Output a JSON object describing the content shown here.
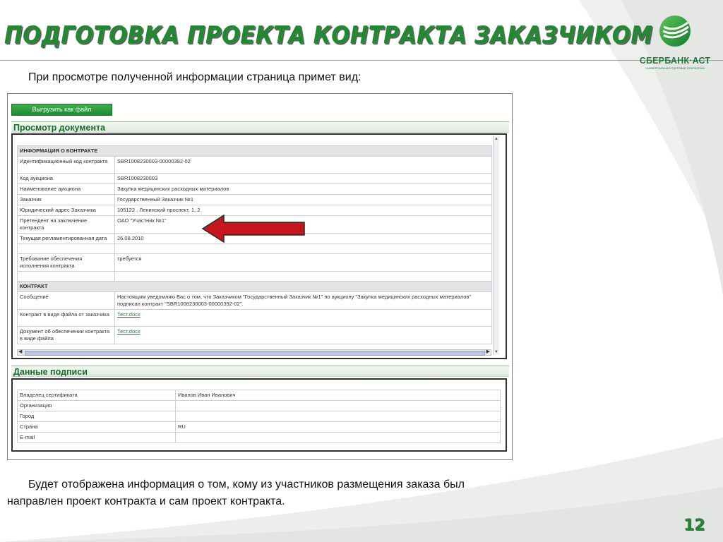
{
  "slide": {
    "title": "ПОДГОТОВКА ПРОЕКТА КОНТРАКТА ЗАКАЗЧИКОМ",
    "intro": "При просмотре полученной информации страница примет вид:",
    "footer_line1": "Будет отображена информация о том, кому из участников размещения заказа был",
    "footer_line2": "направлен проект контракта и сам проект контракта.",
    "page_number": "12"
  },
  "logo": {
    "name": "СБЕРБАНК·АСТ",
    "subtitle": "УНИВЕРСАЛЬНАЯ ТОРГОВАЯ ПЛАТФОРМА"
  },
  "screen": {
    "export_button": "Выгрузить как файл",
    "document_section": "Просмотр документа",
    "signature_section": "Данные подписи",
    "contract_info": {
      "header": "ИНФОРМАЦИЯ О КОНТРАКТЕ",
      "rows": [
        {
          "label": "Идентификационный код контракта",
          "value": "SBR1008230003-00000392-02"
        },
        {
          "label": "Код аукциона",
          "value": "SBR1008230003"
        },
        {
          "label": "Наименование аукциона",
          "value": "Закупка медицинских расходных материалов"
        },
        {
          "label": "Заказчик",
          "value": "Государственный Заказчик №1"
        },
        {
          "label": "Юридический адрес Заказчика",
          "value": "105122 , Ленинский проспект, 1, 2"
        },
        {
          "label": "Претендент на заключение контракта",
          "value": "ОАО \"Участник №1\""
        },
        {
          "label": "Текущая регламентированная дата",
          "value": "26.08.2010"
        },
        {
          "label": "",
          "value": ""
        },
        {
          "label": "Требование обеспечения исполнения контракта",
          "value": "требуется"
        },
        {
          "label": "",
          "value": ""
        }
      ]
    },
    "contract": {
      "header": "КОНТРАКТ",
      "message_label": "Сообщение",
      "message_value": "Настоящим уведомляю Вас о том, что Заказчиком \"Государственный Заказчик №1\" по аукциону \"Закупка медицинских расходных материалов\" подписан контракт \"SBR1008230003-00000392-02\".",
      "contract_file_label": "Контракт в виде файла от заказчика",
      "contract_file_link": "Тест.docx",
      "security_doc_label": "Документ об обеспечении контракта в виде файла",
      "security_doc_link": "Тест.docx"
    },
    "signature": {
      "rows": [
        {
          "label": "Владелец сертификата",
          "value": "Иванов Иван Иванович"
        },
        {
          "label": "Организация",
          "value": ""
        },
        {
          "label": "Город",
          "value": ""
        },
        {
          "label": "Страна",
          "value": "RU"
        },
        {
          "label": "E-mail",
          "value": ""
        }
      ]
    }
  },
  "colors": {
    "brand_green": "#1f8a2f",
    "section_green": "#1c6a2b",
    "arrow_red": "#c4161c"
  }
}
